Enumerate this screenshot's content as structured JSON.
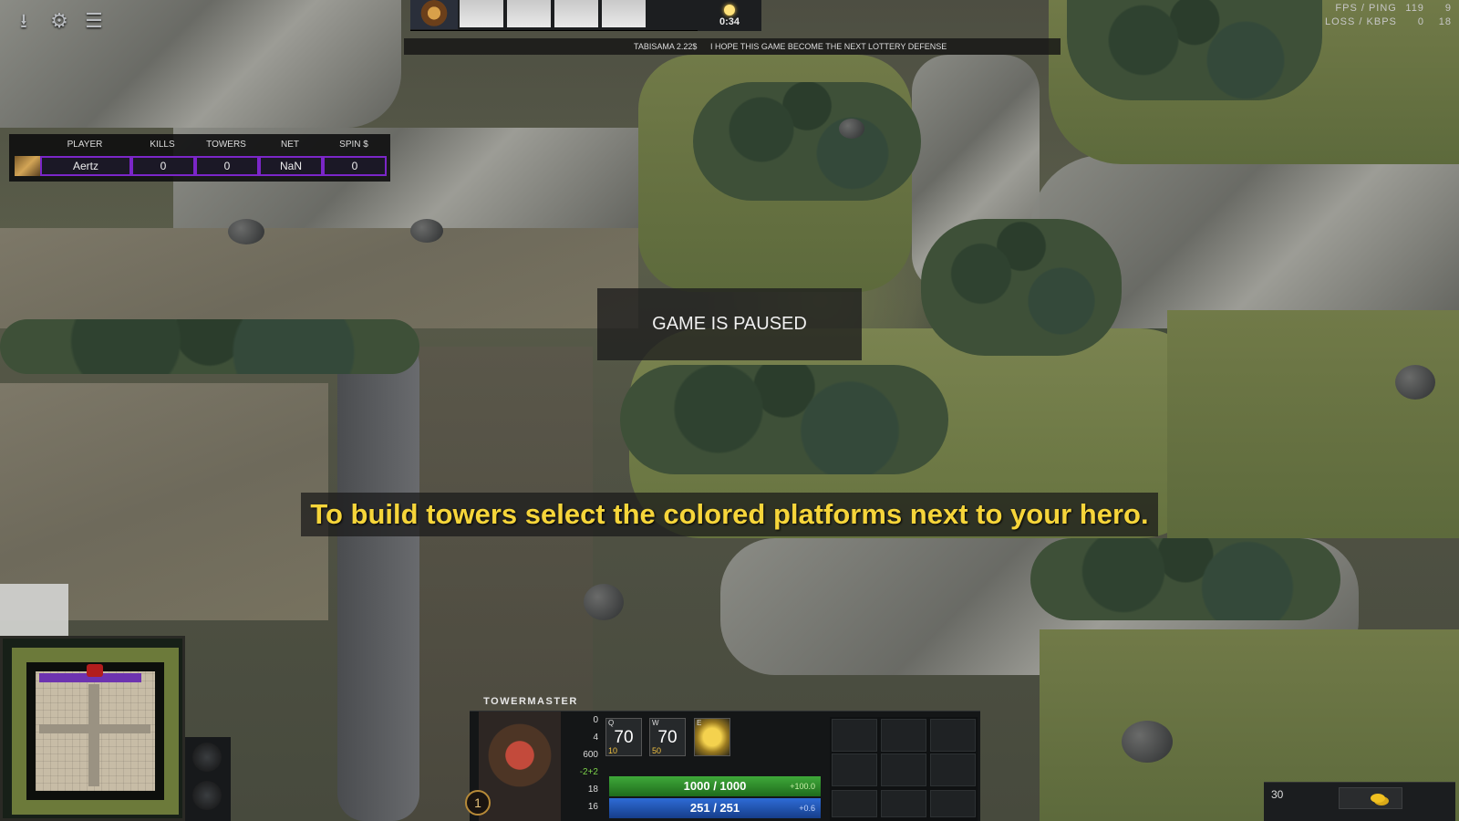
{
  "system_icons": [
    {
      "name": "upload-icon",
      "glyph": "⭳"
    },
    {
      "name": "settings-icon",
      "glyph": "⚙"
    },
    {
      "name": "menu-icon",
      "glyph": "☰"
    }
  ],
  "top_bar": {
    "clock": "0:34"
  },
  "ticker": {
    "player": "TABISAMA 2.22$",
    "message": "I HOPE THIS GAME BECOME THE NEXT LOTTERY DEFENSE"
  },
  "net_stats": {
    "fps_ping_label": "FPS / PING",
    "fps": "119",
    "ping": "9",
    "loss_kbps_label": "LOSS / KBPS",
    "loss": "0",
    "kbps": "18"
  },
  "scoreboard": {
    "headers": [
      "PLAYER",
      "KILLS",
      "TOWERS",
      "NET",
      "SPIN $"
    ],
    "row": [
      "Aertz",
      "0",
      "0",
      "NaN",
      "0"
    ],
    "accent": "#7b26c8"
  },
  "pause_message": "GAME IS PAUSED",
  "hint": "To build towers select the colored platforms next to your hero.",
  "hero": {
    "name": "TOWERMASTER",
    "level": "1",
    "stats": [
      "0",
      "4",
      "600",
      "-2+2",
      "18",
      "16"
    ],
    "abilities": [
      {
        "key": "Q",
        "value": "70",
        "cost": "10"
      },
      {
        "key": "W",
        "value": "70",
        "cost": "50"
      },
      {
        "key": "E",
        "value": "",
        "cost": ""
      }
    ],
    "health": "1000 / 1000",
    "health_regen": "+100.0",
    "mana": "251 / 251",
    "mana_regen": "+0.6"
  },
  "gold": "30",
  "colors": {
    "hint_text": "#f6d53a",
    "health": "#3fa93a",
    "mana": "#2e6bd6"
  }
}
